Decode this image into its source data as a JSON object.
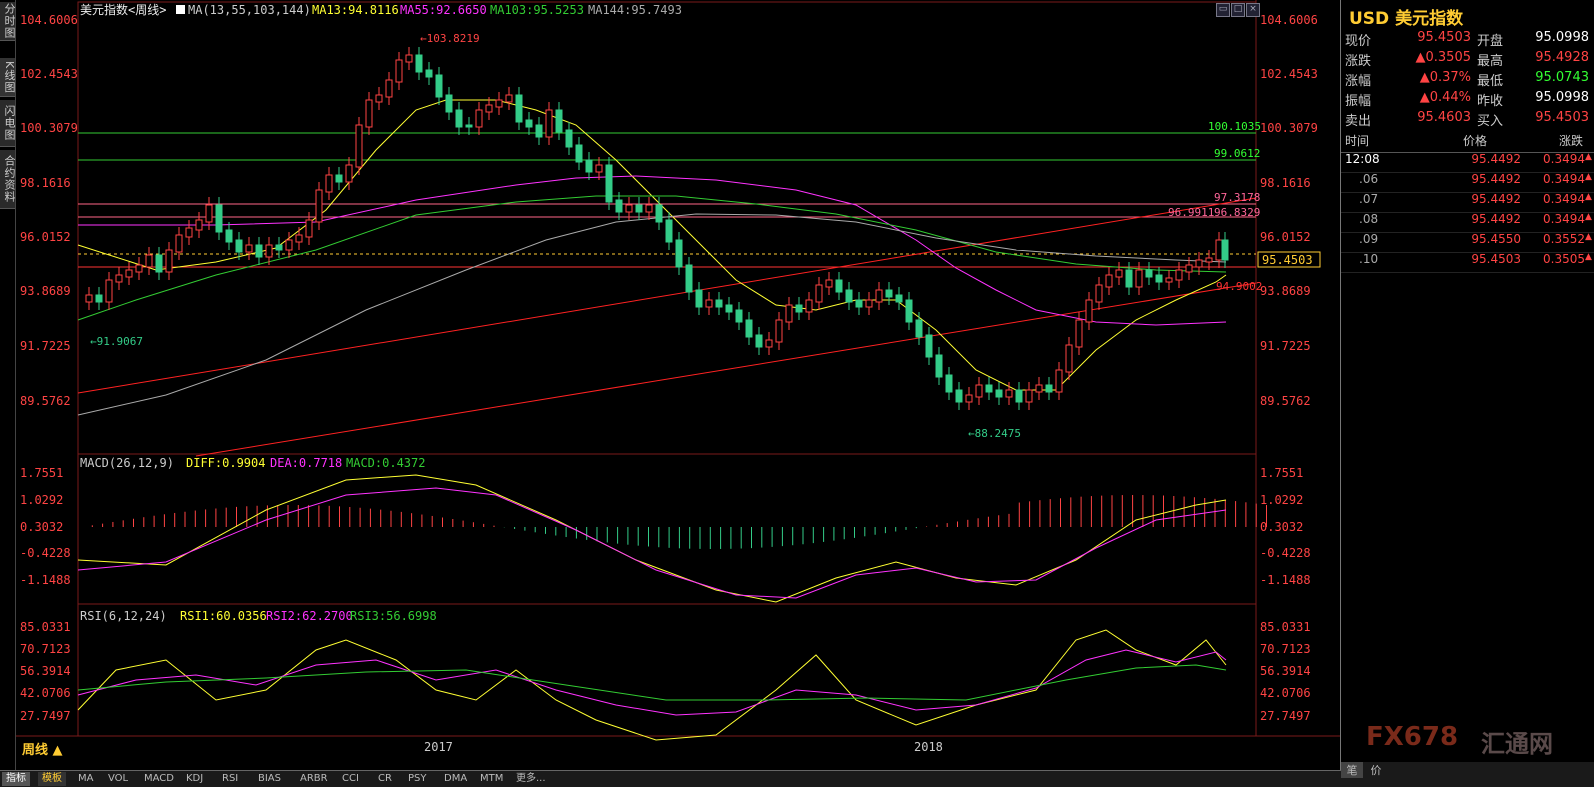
{
  "left_tabs": [
    "分时图",
    "K线图",
    "闪电图",
    "合约资料"
  ],
  "chart": {
    "title_main": "美元指数<周线>",
    "ma_legend": {
      "ma": "MA(13,55,103,144)",
      "ma13": "MA13:94.8116",
      "ma55": "MA55:92.6650",
      "ma103": "MA103:95.5253",
      "ma144": "MA144:95.7493"
    },
    "price_axis": [
      "104.6006",
      "102.4543",
      "100.3079",
      "98.1616",
      "96.0152",
      "93.8689",
      "91.7225",
      "89.5762"
    ],
    "price_annotations": {
      "high": "103.8219",
      "low_left": "91.9067",
      "low": "88.2475",
      "line1": "100.1035",
      "line2": "99.0612",
      "line3": "97.3178",
      "line4": "96.9911",
      "line5": "96.8329",
      "line6": "94.9002",
      "current": "95.4503"
    },
    "macd_legend": {
      "macd": "MACD(26,12,9)",
      "diff": "DIFF:0.9904",
      "dea": "DEA:0.7718",
      "macd_val": "MACD:0.4372"
    },
    "macd_axis": [
      "1.7551",
      "1.0292",
      "0.3032",
      "-0.4228",
      "-1.1488"
    ],
    "rsi_legend": {
      "rsi": "RSI(6,12,24)",
      "rsi1": "RSI1:60.0356",
      "rsi2": "RSI2:62.2700",
      "rsi3": "RSI3:56.6998"
    },
    "rsi_axis": [
      "85.0331",
      "70.7123",
      "56.3914",
      "42.0706",
      "27.7497"
    ],
    "x_labels": [
      "2017",
      "2018"
    ],
    "period_label": "周线",
    "colors": {
      "ma13": "#ffff33",
      "ma55": "#ff33ff",
      "ma103": "#33cc33",
      "ma144": "#aaaaaa",
      "up": "#ff4444",
      "down": "#33cc88"
    }
  },
  "bottom_tabs": [
    "指标",
    "模板",
    "MA",
    "VOL",
    "MACD",
    "KDJ",
    "RSI",
    "BIAS",
    "ARBR",
    "CCI",
    "CR",
    "PSY",
    "DMA",
    "MTM",
    "更多..."
  ],
  "right_panel": {
    "title": "USD 美元指数",
    "quote": [
      {
        "l1": "现价",
        "v1": "95.4503",
        "l2": "开盘",
        "v2": "95.0998"
      },
      {
        "l1": "涨跌",
        "v1": "0.3505",
        "l2": "最高",
        "v2": "95.4928"
      },
      {
        "l1": "涨幅",
        "v1": "0.37%",
        "l2": "最低",
        "v2": "95.0743"
      },
      {
        "l1": "振幅",
        "v1": "0.44%",
        "l2": "昨收",
        "v2": "95.0998"
      },
      {
        "l1": "卖出",
        "v1": "95.4603",
        "l2": "买入",
        "v2": "95.4503"
      }
    ],
    "ticks_header": {
      "time": "时间",
      "price": "价格",
      "change": "涨跌"
    },
    "ticks": [
      {
        "time": "12:08",
        "price": "95.4492",
        "change": "0.3494"
      },
      {
        "time": ".06",
        "price": "95.4492",
        "change": "0.3494"
      },
      {
        "time": ".07",
        "price": "95.4492",
        "change": "0.3494"
      },
      {
        "time": ".08",
        "price": "95.4492",
        "change": "0.3494"
      },
      {
        "time": ".09",
        "price": "95.4550",
        "change": "0.3552"
      },
      {
        "time": ".10",
        "price": "95.4503",
        "change": "0.3505"
      }
    ],
    "bottom_tabs": [
      "笔",
      "价"
    ],
    "logo": "FX678",
    "logo_cn": "汇通网"
  }
}
